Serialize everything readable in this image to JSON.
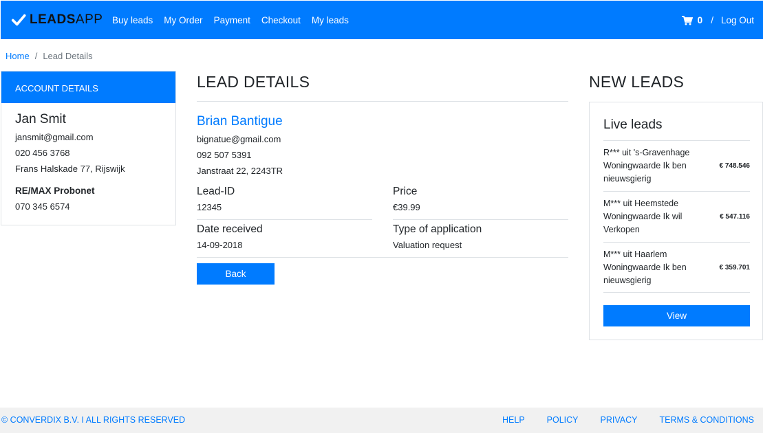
{
  "navbar": {
    "brand_bold": "LEADS",
    "brand_light": "APP",
    "links": [
      "Buy leads",
      "My Order",
      "Payment",
      "Checkout",
      "My leads"
    ],
    "cart_count": "0",
    "separator": "/",
    "logout": "Log Out"
  },
  "breadcrumb": {
    "home": "Home",
    "separator": "/",
    "current": "Lead Details"
  },
  "account": {
    "header": "ACCOUNT DETAILS",
    "name": "Jan Smit",
    "email": "jansmit@gmail.com",
    "phone": "020 456 3768",
    "address": "Frans Halskade 77, Rijswijk",
    "company": "RE/MAX Probonet",
    "company_phone": "070 345 6574"
  },
  "lead": {
    "title": "LEAD DETAILS",
    "name": "Brian Bantigue",
    "email": "bignatue@gmail.com",
    "phone": "092 507 5391",
    "address": "Janstraat 22, 2243TR",
    "id_label": "Lead-ID",
    "id_value": "12345",
    "price_label": "Price",
    "price_value": "€39.99",
    "date_label": "Date received",
    "date_value": "14-09-2018",
    "type_label": "Type of application",
    "type_value": "Valuation request",
    "back_label": "Back"
  },
  "new_leads": {
    "title": "NEW LEADS",
    "card_title": "Live leads",
    "items": [
      {
        "text": "R*** uit 's-Gravenhage Woningwaarde Ik ben nieuwsgierig",
        "price": "€ 748.546"
      },
      {
        "text": "M*** uit Heemstede Woningwaarde Ik wil Verkopen",
        "price": "€ 547.116"
      },
      {
        "text": "M*** uit Haarlem Woningwaarde Ik ben nieuwsgierig",
        "price": "€ 359.701"
      }
    ],
    "view_label": "View"
  },
  "footer": {
    "copyright": "© CONVERDIX B.V. I ALL RIGHTS RESERVED",
    "links": [
      "HELP",
      "POLICY",
      "PRIVACY",
      "TERMS & CONDITIONS"
    ]
  },
  "icons": {
    "brand": "check-icon",
    "cart": "cart-icon"
  },
  "colors": {
    "primary": "#007bff",
    "footer_bg": "#f1f1f1"
  }
}
